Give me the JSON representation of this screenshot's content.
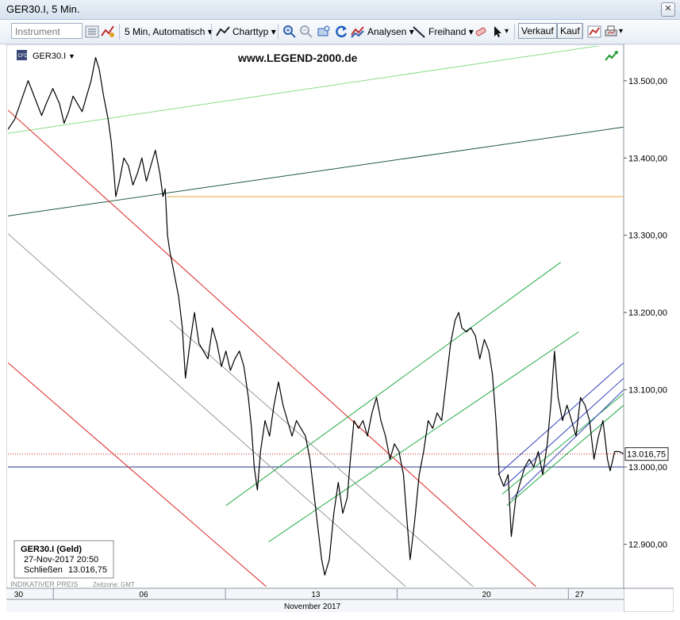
{
  "window": {
    "title": "GER30.I, 5 Min.",
    "close_icon": "close-icon"
  },
  "toolbar": {
    "instrument_placeholder": "Instrument",
    "interval_label": "5 Min, Automatisch",
    "charttype_label": "Charttyp",
    "analysis_label": "Analysen",
    "freehand_label": "Freihand",
    "sell_label": "Verkauf",
    "buy_label": "Kauf"
  },
  "chart_data": {
    "type": "line",
    "symbol_label": "GER30.I",
    "watermark": "www.LEGEND-2000.de",
    "price_axis_labels": [
      "13.500,00",
      "13.400,00",
      "13.300,00",
      "13.200,00",
      "13.100,00",
      "13.000,00",
      "12.900,00"
    ],
    "price_axis_values": [
      13500,
      13400,
      13300,
      13200,
      13100,
      13000,
      12900
    ],
    "ylim": [
      12845,
      13545
    ],
    "time_tick_labels": [
      "30",
      "06",
      "13",
      "20",
      "27"
    ],
    "month_label": "November 2017",
    "last_price_label": "13.016,75",
    "last_price": 13016.75,
    "reference_price": 13000,
    "info_box": {
      "title": "GER30.I (Geld)",
      "date": "27-Nov-2017 20:50",
      "close_label": "Schließen",
      "close_value": "13.016,75"
    },
    "footer_note": "INDIKATIVER PREIS",
    "timezone_note": "Zeitzone: GMT",
    "colors": {
      "price": "#000000",
      "red_channel": "#dd2222",
      "gray_channel": "#999999",
      "light_green": "#88dd88",
      "dark_green": "#1f5a3a",
      "orange_level": "#e8a040",
      "green_channel": "#22aa44",
      "blue_channel": "#3344bb",
      "reference_line": "#223388",
      "last_price_line": "#cc2222"
    },
    "price_series": [
      [
        0.0,
        13437
      ],
      [
        1.5,
        13450
      ],
      [
        3.0,
        13475
      ],
      [
        4.5,
        13500
      ],
      [
        5.5,
        13485
      ],
      [
        6.5,
        13470
      ],
      [
        7.5,
        13455
      ],
      [
        8.5,
        13470
      ],
      [
        10.0,
        13490
      ],
      [
        11.5,
        13470
      ],
      [
        12.5,
        13445
      ],
      [
        13.5,
        13460
      ],
      [
        14.5,
        13480
      ],
      [
        15.5,
        13470
      ],
      [
        16.5,
        13460
      ],
      [
        17.5,
        13480
      ],
      [
        18.5,
        13500
      ],
      [
        19.5,
        13530
      ],
      [
        20.3,
        13515
      ],
      [
        21.3,
        13480
      ],
      [
        22.3,
        13450
      ],
      [
        23.0,
        13420
      ],
      [
        23.6,
        13380
      ],
      [
        24.0,
        13350
      ],
      [
        24.8,
        13370
      ],
      [
        25.8,
        13400
      ],
      [
        26.8,
        13390
      ],
      [
        27.8,
        13365
      ],
      [
        28.8,
        13380
      ],
      [
        29.8,
        13400
      ],
      [
        30.8,
        13370
      ],
      [
        31.8,
        13390
      ],
      [
        32.8,
        13410
      ],
      [
        33.8,
        13380
      ],
      [
        34.5,
        13350
      ],
      [
        35.0,
        13360
      ],
      [
        35.5,
        13300
      ],
      [
        36.0,
        13280
      ],
      [
        37.0,
        13250
      ],
      [
        38.0,
        13220
      ],
      [
        38.8,
        13180
      ],
      [
        39.5,
        13115
      ],
      [
        40.5,
        13160
      ],
      [
        41.5,
        13200
      ],
      [
        42.5,
        13160
      ],
      [
        43.5,
        13150
      ],
      [
        44.5,
        13140
      ],
      [
        45.5,
        13180
      ],
      [
        46.5,
        13160
      ],
      [
        47.5,
        13130
      ],
      [
        48.5,
        13150
      ],
      [
        49.5,
        13125
      ],
      [
        50.5,
        13140
      ],
      [
        51.5,
        13150
      ],
      [
        52.5,
        13130
      ],
      [
        53.5,
        13090
      ],
      [
        54.2,
        13050
      ],
      [
        54.8,
        13000
      ],
      [
        55.5,
        12970
      ],
      [
        56.2,
        13020
      ],
      [
        57.2,
        13060
      ],
      [
        58.2,
        13040
      ],
      [
        59.2,
        13080
      ],
      [
        60.2,
        13110
      ],
      [
        61.2,
        13080
      ],
      [
        62.2,
        13060
      ],
      [
        63.2,
        13040
      ],
      [
        64.2,
        13060
      ],
      [
        65.2,
        13050
      ],
      [
        66.2,
        13040
      ],
      [
        67.2,
        13010
      ],
      [
        68.2,
        12960
      ],
      [
        69.0,
        12920
      ],
      [
        69.8,
        12880
      ],
      [
        70.5,
        12860
      ],
      [
        71.5,
        12880
      ],
      [
        72.5,
        12940
      ],
      [
        73.5,
        12980
      ],
      [
        74.5,
        12940
      ],
      [
        75.5,
        12960
      ],
      [
        76.2,
        13010
      ],
      [
        77.0,
        13060
      ],
      [
        78.0,
        13050
      ],
      [
        79.0,
        13060
      ],
      [
        80.0,
        13040
      ],
      [
        81.0,
        13070
      ],
      [
        82.0,
        13090
      ],
      [
        83.0,
        13060
      ],
      [
        84.0,
        13040
      ],
      [
        85.0,
        13010
      ],
      [
        86.0,
        13030
      ],
      [
        87.0,
        13020
      ],
      [
        88.0,
        12990
      ],
      [
        88.8,
        12930
      ],
      [
        89.5,
        12880
      ],
      [
        90.5,
        12930
      ],
      [
        91.5,
        12990
      ],
      [
        92.5,
        13020
      ],
      [
        93.5,
        13060
      ],
      [
        94.5,
        13050
      ],
      [
        95.5,
        13070
      ],
      [
        96.5,
        13060
      ],
      [
        97.5,
        13110
      ],
      [
        98.5,
        13160
      ],
      [
        99.5,
        13190
      ],
      [
        100.3,
        13200
      ],
      [
        101.0,
        13180
      ],
      [
        102.0,
        13175
      ],
      [
        103.0,
        13180
      ],
      [
        104.0,
        13170
      ],
      [
        105.0,
        13140
      ],
      [
        106.0,
        13165
      ],
      [
        107.0,
        13150
      ],
      [
        107.8,
        13120
      ],
      [
        108.6,
        13060
      ],
      [
        109.3,
        12990
      ],
      [
        110.3,
        12975
      ],
      [
        111.3,
        12990
      ],
      [
        112.0,
        12910
      ],
      [
        113.0,
        12960
      ],
      [
        114.0,
        12980
      ],
      [
        115.0,
        13000
      ],
      [
        116.0,
        13010
      ],
      [
        117.0,
        13000
      ],
      [
        118.0,
        13020
      ],
      [
        119.0,
        12990
      ],
      [
        120.0,
        13030
      ],
      [
        120.8,
        13080
      ],
      [
        121.6,
        13150
      ],
      [
        122.4,
        13090
      ],
      [
        123.4,
        13060
      ],
      [
        124.4,
        13080
      ],
      [
        125.4,
        13060
      ],
      [
        126.4,
        13040
      ],
      [
        127.4,
        13090
      ],
      [
        128.4,
        13080
      ],
      [
        129.4,
        13060
      ],
      [
        130.4,
        13010
      ],
      [
        131.4,
        13040
      ],
      [
        132.4,
        13060
      ],
      [
        133.4,
        13010
      ],
      [
        134.0,
        12995
      ],
      [
        135.0,
        13020
      ],
      [
        136.0,
        13020
      ],
      [
        137.0,
        13017
      ]
    ],
    "trend_lines": [
      {
        "color": "light_green",
        "x": [
          0,
          137
        ],
        "y": [
          13432,
          13550
        ]
      },
      {
        "color": "dark_green",
        "x": [
          0,
          137
        ],
        "y": [
          13325,
          13440
        ]
      },
      {
        "color": "orange_level",
        "x": [
          35.5,
          137
        ],
        "y": [
          13350,
          13350
        ]
      },
      {
        "color": "red_channel",
        "x": [
          0,
          117.5
        ],
        "y": [
          13462,
          12845
        ]
      },
      {
        "color": "red_channel",
        "x": [
          0,
          57.5
        ],
        "y": [
          13135,
          12845
        ]
      },
      {
        "color": "gray_channel",
        "x": [
          0,
          88.5
        ],
        "y": [
          13302,
          12845
        ]
      },
      {
        "color": "gray_channel",
        "x": [
          36.0,
          103.5
        ],
        "y": [
          13190,
          12845
        ]
      },
      {
        "color": "green_channel",
        "x": [
          48.5,
          123.0
        ],
        "y": [
          12950,
          13265
        ]
      },
      {
        "color": "green_channel",
        "x": [
          58.0,
          127.0
        ],
        "y": [
          12903,
          13175
        ]
      },
      {
        "color": "green_channel",
        "x": [
          111.0,
          137.0
        ],
        "y": [
          12950,
          13080
        ]
      },
      {
        "color": "green_channel",
        "x": [
          110.0,
          137.0
        ],
        "y": [
          12965,
          13095
        ]
      },
      {
        "color": "blue_channel",
        "x": [
          109.0,
          137.0
        ],
        "y": [
          12990,
          13135
        ]
      },
      {
        "color": "blue_channel",
        "x": [
          110.5,
          137.0
        ],
        "y": [
          12975,
          13115
        ]
      },
      {
        "color": "blue_channel",
        "x": [
          112.0,
          137.0
        ],
        "y": [
          12958,
          13100
        ]
      }
    ],
    "xlim": [
      0,
      137
    ],
    "time_tick_positions": [
      1.4,
      29.2,
      67.5,
      105.5,
      126.2
    ],
    "time_separators": [
      10.1,
      48.4,
      86.6,
      124.7
    ],
    "legend": "none",
    "grid": false
  }
}
